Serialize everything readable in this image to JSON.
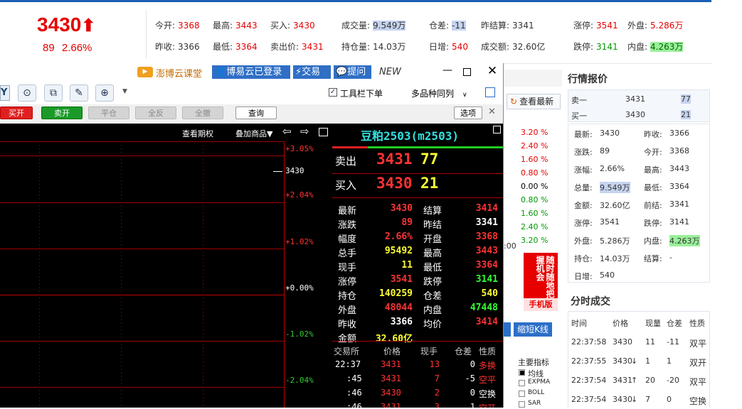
{
  "top": {
    "price": "3430",
    "arrow": "🡑",
    "change": "89",
    "change_pct": "2.66%",
    "cols": [
      [
        {
          "label": "今开:",
          "value": "3368",
          "cls": "red"
        },
        {
          "label": "昨收:",
          "value": "3366",
          "cls": ""
        }
      ],
      [
        {
          "label": "最高:",
          "value": "3443",
          "cls": "red"
        },
        {
          "label": "最低:",
          "value": "3364",
          "cls": "red"
        }
      ],
      [
        {
          "label": "买入:",
          "value": "3430",
          "cls": "red"
        },
        {
          "label": "卖出价:",
          "value": "3431",
          "cls": "red"
        }
      ],
      [
        {
          "label": "成交量:",
          "value": "9.549万",
          "cls": "hl"
        },
        {
          "label": "持仓量:",
          "value": "14.03万",
          "cls": ""
        }
      ],
      [
        {
          "label": "仓差:",
          "value": "-11",
          "cls": "hl"
        },
        {
          "label": "日增:",
          "value": "540",
          "cls": "red"
        }
      ],
      [
        {
          "label": "昨结算:",
          "value": "3341",
          "cls": ""
        },
        {
          "label": "成交额:",
          "value": "32.60亿",
          "cls": ""
        }
      ],
      [
        {
          "label": "涨停:",
          "value": "3541",
          "cls": "red"
        },
        {
          "label": "跌停:",
          "value": "3141",
          "cls": "green"
        }
      ],
      [
        {
          "label": "外盘:",
          "value": "5.286万",
          "cls": "red"
        },
        {
          "label": "内盘:",
          "value": "4.263万",
          "cls": "hlg"
        }
      ]
    ]
  },
  "window": {
    "promo_links": [
      "澎博云课堂",
      "博易云已登录",
      "交易",
      "提问"
    ],
    "new_label": "NEW",
    "toolbar_check": "工具栏下单",
    "multi_label": "多品种同列",
    "trade_buttons": [
      "买开",
      "卖开",
      "平仓",
      "全反",
      "全撤"
    ],
    "query_btn": "查询",
    "options_btn": "选项",
    "chart_header": {
      "options": "查看期权",
      "overlay": "叠加商品▼"
    },
    "pct_labels": [
      "+3.05%",
      "+2.04%",
      "+1.02%",
      "+0.00%",
      "-1.02%",
      "-2.04%"
    ],
    "price_marker": "3430",
    "quote": {
      "title": "豆粕2503(m2503)",
      "sell_label": "卖出",
      "sell_price": "3431",
      "sell_vol": "77",
      "buy_label": "买入",
      "buy_price": "3430",
      "buy_vol": "21",
      "rows": [
        {
          "l1": "最新",
          "v1": "3430",
          "c1": "qred",
          "l2": "结算",
          "v2": "3414",
          "c2": "qred"
        },
        {
          "l1": "涨跌",
          "v1": "89",
          "c1": "qred",
          "l2": "昨结",
          "v2": "3341",
          "c2": "qwhite"
        },
        {
          "l1": "幅度",
          "v1": "2.66%",
          "c1": "qred",
          "l2": "开盘",
          "v2": "3368",
          "c2": "qred"
        },
        {
          "l1": "总手",
          "v1": "95492",
          "c1": "yellow",
          "l2": "最高",
          "v2": "3443",
          "c2": "qred"
        },
        {
          "l1": "现手",
          "v1": "11",
          "c1": "yellow",
          "l2": "最低",
          "v2": "3364",
          "c2": "qred"
        },
        {
          "l1": "涨停",
          "v1": "3541",
          "c1": "qred",
          "l2": "跌停",
          "v2": "3141",
          "c2": "qgreen"
        },
        {
          "l1": "持仓",
          "v1": "140259",
          "c1": "yellow",
          "l2": "仓差",
          "v2": "540",
          "c2": "yellow"
        },
        {
          "l1": "外盘",
          "v1": "48044",
          "c1": "qred",
          "l2": "内盘",
          "v2": "47448",
          "c2": "qgreen"
        },
        {
          "l1": "昨收",
          "v1": "3366",
          "c1": "qwhite",
          "l2": "均价",
          "v2": "3414",
          "c2": "qred"
        },
        {
          "l1": "金额",
          "v1": "32.60亿",
          "c1": "yellow",
          "l2": "",
          "v2": "",
          "c2": ""
        }
      ],
      "tick_header": [
        "交易所",
        "价格",
        "现手",
        "仓差",
        "性质"
      ],
      "ticks": [
        {
          "t": "22:37",
          "p": "3431",
          "v": "13",
          "d": "0",
          "n": "多换",
          "nc": "qred"
        },
        {
          "t": ":45",
          "p": "3431",
          "v": "7",
          "d": "-5",
          "n": "空平",
          "nc": "qred"
        },
        {
          "t": ":46",
          "p": "3430",
          "v": "2",
          "d": "0",
          "n": "空换",
          "nc": "qwhite"
        },
        {
          "t": ":46",
          "p": "3431",
          "v": "3",
          "d": "1",
          "n": "空开",
          "nc": "qred"
        }
      ]
    }
  },
  "mid": {
    "pcts": [
      {
        "v": "3.20 %",
        "c": "red"
      },
      {
        "v": "2.40 %",
        "c": "red"
      },
      {
        "v": "1.60 %",
        "c": "red"
      },
      {
        "v": "0.80 %",
        "c": "red"
      },
      {
        "v": "0.00 %",
        "c": ""
      },
      {
        "v": "0.80 %",
        "c": "green"
      },
      {
        "v": "1.60 %",
        "c": "green"
      },
      {
        "v": "2.40 %",
        "c": "green"
      },
      {
        "v": "3.20 %",
        "c": "green"
      }
    ],
    "time_fragment": ":00",
    "refresh_label": "查看最新",
    "ad_text": "随时随地把握机会",
    "ad_sub": "手机版",
    "short_k": "缩短K线",
    "indicator_title": "主要指标",
    "indicators": [
      "均线",
      "EXPMA",
      "BOLL",
      "SAR"
    ]
  },
  "right": {
    "title": "行情报价",
    "ask": {
      "label": "卖一",
      "price": "3431",
      "vol": "77"
    },
    "bid": {
      "label": "买一",
      "price": "3430",
      "vol": "21"
    },
    "rows": [
      {
        "l1": "最新:",
        "v1": "3430",
        "c1": "red",
        "l2": "昨收:",
        "v2": "3366",
        "c2": ""
      },
      {
        "l1": "涨跌:",
        "v1": "89",
        "c1": "red",
        "l2": "今开:",
        "v2": "3368",
        "c2": "red"
      },
      {
        "l1": "涨幅:",
        "v1": "2.66%",
        "c1": "red",
        "l2": "最高:",
        "v2": "3443",
        "c2": "red"
      },
      {
        "l1": "总量:",
        "v1": "9.549万",
        "c1": "hl",
        "l2": "最低:",
        "v2": "3364",
        "c2": "red"
      },
      {
        "l1": "金额:",
        "v1": "32.60亿",
        "c1": "",
        "l2": "前结:",
        "v2": "3341",
        "c2": ""
      },
      {
        "l1": "涨停:",
        "v1": "3541",
        "c1": "red",
        "l2": "跌停:",
        "v2": "3141",
        "c2": "green"
      },
      {
        "l1": "外盘:",
        "v1": "5.286万",
        "c1": "red",
        "l2": "内盘:",
        "v2": "4.263万",
        "c2": "hlg"
      },
      {
        "l1": "持仓:",
        "v1": "14.03万",
        "c1": "",
        "l2": "结算:",
        "v2": "-",
        "c2": ""
      },
      {
        "l1": "日增:",
        "v1": "540",
        "c1": "red",
        "l2": "",
        "v2": "",
        "c2": ""
      }
    ],
    "trades_title": "分时成交",
    "trades_header": [
      "时间",
      "价格",
      "现量",
      "仓差",
      "性质"
    ],
    "trades": [
      {
        "t": "22:37:58",
        "p": "3430",
        "dir": "",
        "v": "11",
        "d": "-11",
        "n": "双平",
        "nc": "red"
      },
      {
        "t": "22:37:55",
        "p": "3430",
        "dir": "↓",
        "v": "1",
        "d": "1",
        "n": "双开",
        "nc": "green"
      },
      {
        "t": "22:37:54",
        "p": "3431",
        "dir": "↑",
        "v": "20",
        "d": "-20",
        "n": "双平",
        "nc": "red"
      },
      {
        "t": "22:37:54",
        "p": "3430",
        "dir": "↓",
        "v": "7",
        "d": "0",
        "n": "空换",
        "nc": "green"
      }
    ]
  }
}
